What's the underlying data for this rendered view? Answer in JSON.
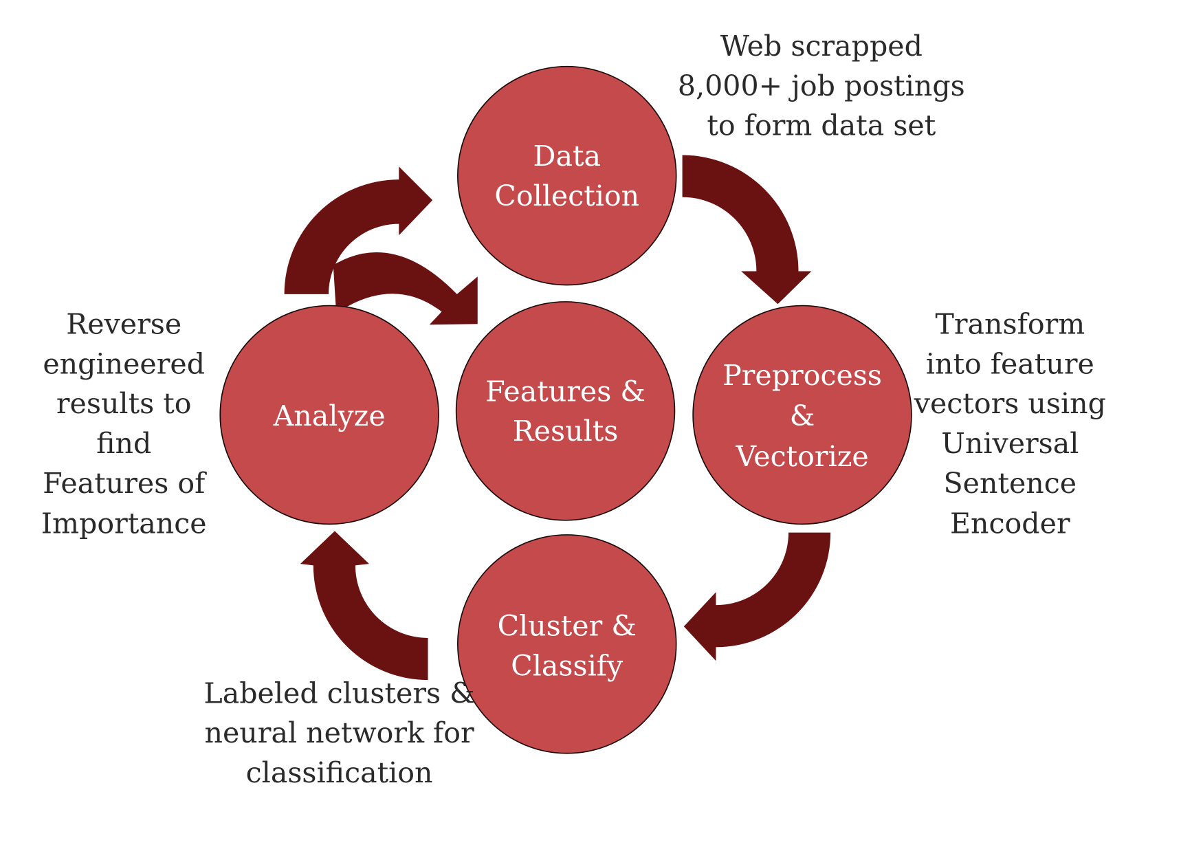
{
  "colors": {
    "node_fill": "#c44a4c",
    "arrow": "#6a1212",
    "text": "#2a2a2a"
  },
  "nodes": {
    "data_collection": [
      "Data",
      "Collection"
    ],
    "features_results": [
      "Features &",
      "Results"
    ],
    "analyze": [
      "Analyze"
    ],
    "preprocess": [
      "Preprocess",
      "&",
      "Vectorize"
    ],
    "cluster": [
      "Cluster &",
      "Classify"
    ]
  },
  "notes": {
    "top": [
      "Web scrapped",
      "8,000+ job postings",
      "to form data set"
    ],
    "right": [
      "Transform",
      "into feature",
      "vectors using",
      "Universal",
      "Sentence",
      "Encoder"
    ],
    "left": [
      "Reverse",
      "engineered",
      "results to",
      "find",
      "Features of",
      "Importance"
    ],
    "bottom": [
      "Labeled clusters &",
      "neural network for",
      "classification"
    ]
  }
}
